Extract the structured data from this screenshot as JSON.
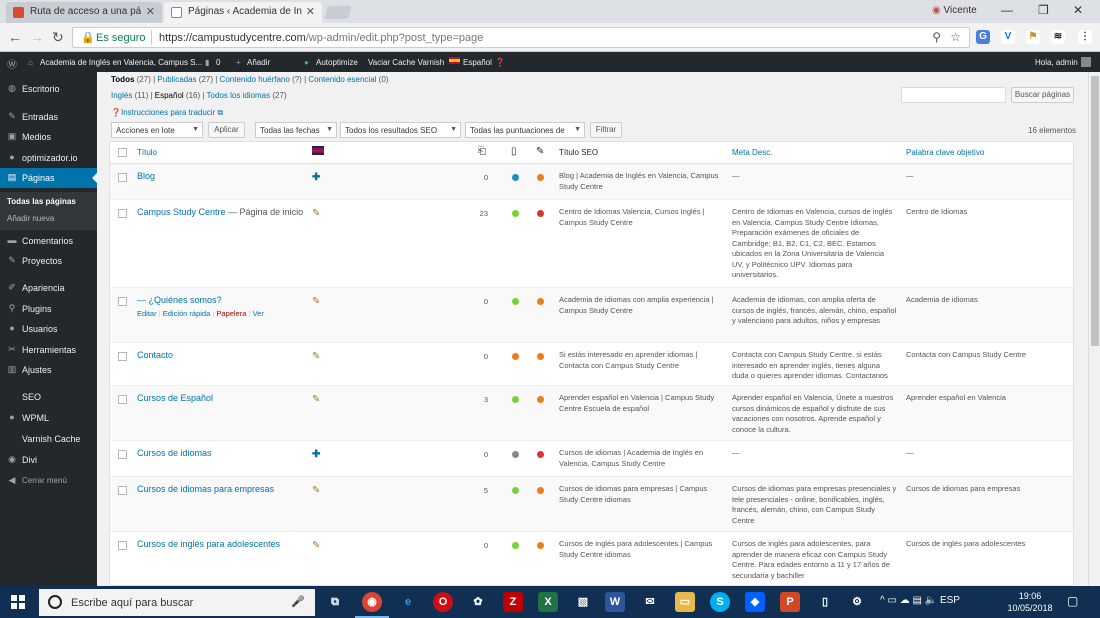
{
  "browser": {
    "tabs": [
      {
        "label": "Ruta de acceso a una pá",
        "favicon_color": "#d64b32"
      },
      {
        "label": "Páginas ‹ Academia de In",
        "favicon_color": "#888888"
      }
    ],
    "profile": "Vicente",
    "secure_label": "Es seguro",
    "url_host": "https://campustudycentre.com",
    "url_path": "/wp-admin/edit.php?post_type=page"
  },
  "adminbar": {
    "site": "Academia de Inglés en Valencia, Campus S...",
    "comments": "0",
    "add": "Añadir",
    "autoptimize": "Autoptimize",
    "varnish": "Vaciar Cache Varnish",
    "language": "Español",
    "greeting": "Hola, admin"
  },
  "sidebar": {
    "items": [
      {
        "label": "Escritorio",
        "icon": "dashboard-icon",
        "glyph": "◍"
      },
      {
        "label": "Entradas",
        "icon": "pin-icon",
        "glyph": "✎"
      },
      {
        "label": "Medios",
        "icon": "media-icon",
        "glyph": "▣"
      },
      {
        "label": "optimizador.io",
        "icon": "optimizer-icon",
        "glyph": "●"
      },
      {
        "label": "Páginas",
        "icon": "pages-icon",
        "glyph": "▤"
      },
      {
        "label": "Comentarios",
        "icon": "comments-icon",
        "glyph": "▬"
      },
      {
        "label": "Proyectos",
        "icon": "projects-icon",
        "glyph": "✎"
      },
      {
        "label": "Apariencia",
        "icon": "appearance-icon",
        "glyph": "✐"
      },
      {
        "label": "Plugins",
        "icon": "plugins-icon",
        "glyph": "⚲"
      },
      {
        "label": "Usuarios",
        "icon": "users-icon",
        "glyph": "●"
      },
      {
        "label": "Herramientas",
        "icon": "tools-icon",
        "glyph": "✂"
      },
      {
        "label": "Ajustes",
        "icon": "settings-icon",
        "glyph": "▥"
      },
      {
        "label": "SEO",
        "icon": "",
        "glyph": ""
      },
      {
        "label": "WPML",
        "icon": "wpml-icon",
        "glyph": "●"
      },
      {
        "label": "Varnish Cache",
        "icon": "",
        "glyph": ""
      },
      {
        "label": "Divi",
        "icon": "divi-icon",
        "glyph": "◉"
      },
      {
        "label": "Cerrar menú",
        "icon": "collapse-icon",
        "glyph": "◀"
      }
    ],
    "submenu": [
      "Todas las páginas",
      "Añadir nueva"
    ]
  },
  "filters": {
    "status_links": [
      {
        "label": "Todos",
        "count": "(27)"
      },
      {
        "label": "Publicadas",
        "count": "(27)"
      },
      {
        "label": "Contenido huérfano",
        "count": "(?)"
      },
      {
        "label": "Contenido esencial",
        "count": "(0)"
      }
    ],
    "lang_links": [
      {
        "label": "Inglés",
        "count": "(11)"
      },
      {
        "label": "Español",
        "count": "(16)"
      },
      {
        "label": "Todos los idiomas",
        "count": "(27)"
      }
    ],
    "translate_link": "Instrucciones para traducir",
    "search_button": "Buscar páginas",
    "bulk_action": "Acciones en lote",
    "apply": "Aplicar",
    "dates": "Todas las fechas",
    "seo_results": "Todos los resultados SEO",
    "readability": "Todas las puntuaciones de",
    "filter": "Filtrar",
    "item_count": "16 elementos"
  },
  "table": {
    "headers": {
      "title": "Título",
      "seo_title": "Título SEO",
      "meta_desc": "Meta Desc.",
      "focus_kw": "Palabra clave objetivo"
    },
    "rows": [
      {
        "title": "Blog",
        "state": "",
        "lang": "plus",
        "links": "0",
        "seo_color": "#1e8cbe",
        "read_color": "#ee7c1b",
        "seo_title": "Blog | Academia de Inglés en Valencia, Campus Study Centre",
        "meta": "—",
        "kw": "—"
      },
      {
        "title": "Campus Study Centre",
        "state": " — Página de inicio",
        "lang": "pencil",
        "links": "23",
        "seo_color": "#7ad03a",
        "read_color": "#dc3232",
        "seo_title": "Centro de Idiomas Valencia, Cursos Inglés | Campus Study Centre",
        "meta": "Centro de Idiomas en Valencia, cursos de inglés en Valencia, Campus Study Centre Idiomas, Preparación exámenes de oficiales de Cambridge; B1, B2, C1, C2, BEC. Estamos ubicados en la Zona Universitaria de Valencia UV, y Politécnico UPV. Idiomas para universitarios.",
        "kw": "Centro de Idiomas"
      },
      {
        "title": "— ¿Quiénes somos?",
        "state": "",
        "lang": "pencil",
        "links": "0",
        "seo_color": "#7ad03a",
        "read_color": "#ee7c1b",
        "seo_title": "Academia de idiomas con amplia experiencia | Campus Study Centre",
        "meta": "Academia de idiomas, con amplia oferta de cursos de inglés, francés, alemán, chino, español y valenciano para adultos, niños y empresas",
        "kw": "Academia de idiomas",
        "actions": {
          "edit": "Editar",
          "quick": "Edición rápida",
          "trash": "Papelera",
          "view": "Ver"
        }
      },
      {
        "title": "Contacto",
        "state": "",
        "lang": "pencil",
        "links": "0",
        "seo_color": "#ee7c1b",
        "read_color": "#ee7c1b",
        "seo_title": "Si estás interesado en aprender idiomas | Contacta con Campus Study Centre",
        "meta": "Contacta con Campus Study Centre, si estás interesado en aprender inglés, tienes alguna duda o quieres aprender idiomas. Contactanos",
        "kw": "Contacta con Campus Study Centre"
      },
      {
        "title": "Cursos de Español",
        "state": "",
        "lang": "pencil",
        "links": "3",
        "seo_color": "#7ad03a",
        "read_color": "#ee7c1b",
        "seo_title": "Aprender español en Valencia | Campus Study Centre Escuela de español",
        "meta": "Aprender español en Valencia, Únete a nuestros cursos dinámicos de español y disfrute de sus vacaciones con nosotros. Aprende español y conoce la cultura.",
        "kw": "Aprender español en Valencia"
      },
      {
        "title": "Cursos de idiomas",
        "state": "",
        "lang": "plus",
        "links": "0",
        "seo_color": "#888888",
        "read_color": "#dc3232",
        "seo_title": "Cursos de idiomas | Academia de Inglés en Valencia, Campus Study Centre",
        "meta": "—",
        "kw": "—"
      },
      {
        "title": "Cursos de idiomas para empresas",
        "state": "",
        "lang": "pencil",
        "links": "5",
        "seo_color": "#7ad03a",
        "read_color": "#ee7c1b",
        "seo_title": "Cursos de idiomas para empresas | Campus Study Centre idiomas",
        "meta": "Cursos de idiomas para empresas presenciales y tele presenciales - online, bonificables, inglés, francés, alemán, chino, con Campus Study Centre",
        "kw": "Cursos de idiomas para empresas"
      },
      {
        "title": "Cursos de inglés para adolescentes",
        "state": "",
        "lang": "pencil",
        "links": "0",
        "seo_color": "#7ad03a",
        "read_color": "#ee7c1b",
        "seo_title": "Cursos de inglés para adolescentes | Campus Study Centre idiomas",
        "meta": "Cursos de inglés para adolescentes, para aprender de manera eficaz con Campus Study Centre. Para edades entorno a 11 y 17 años de secundaria y bachiller",
        "kw": "Cursos de inglés para adolescentes"
      }
    ]
  },
  "taskbar": {
    "search_placeholder": "Escribe aquí para buscar",
    "lang": "ESP",
    "time": "19:06",
    "date": "10/05/2018"
  }
}
